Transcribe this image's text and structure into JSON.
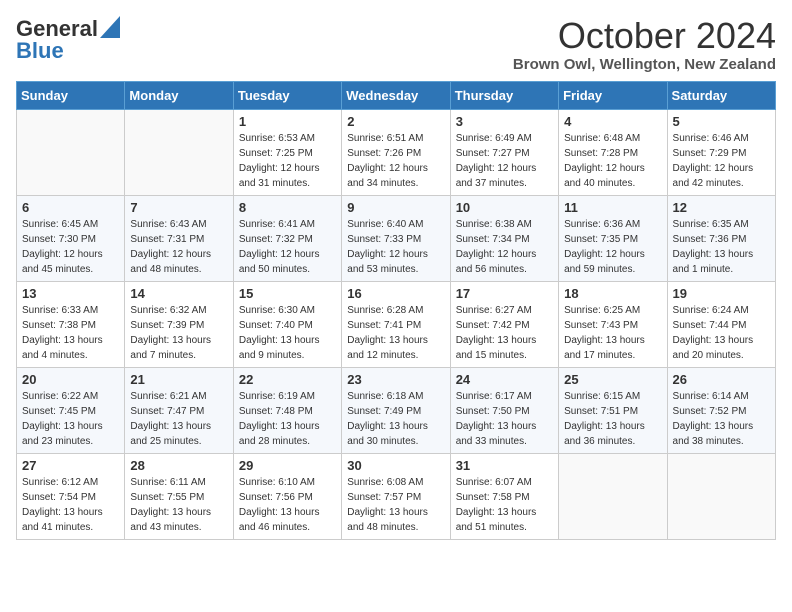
{
  "header": {
    "logo_line1": "General",
    "logo_line2": "Blue",
    "month": "October 2024",
    "location": "Brown Owl, Wellington, New Zealand"
  },
  "days_of_week": [
    "Sunday",
    "Monday",
    "Tuesday",
    "Wednesday",
    "Thursday",
    "Friday",
    "Saturday"
  ],
  "weeks": [
    [
      {
        "day": "",
        "sunrise": "",
        "sunset": "",
        "daylight": ""
      },
      {
        "day": "",
        "sunrise": "",
        "sunset": "",
        "daylight": ""
      },
      {
        "day": "1",
        "sunrise": "Sunrise: 6:53 AM",
        "sunset": "Sunset: 7:25 PM",
        "daylight": "Daylight: 12 hours and 31 minutes."
      },
      {
        "day": "2",
        "sunrise": "Sunrise: 6:51 AM",
        "sunset": "Sunset: 7:26 PM",
        "daylight": "Daylight: 12 hours and 34 minutes."
      },
      {
        "day": "3",
        "sunrise": "Sunrise: 6:49 AM",
        "sunset": "Sunset: 7:27 PM",
        "daylight": "Daylight: 12 hours and 37 minutes."
      },
      {
        "day": "4",
        "sunrise": "Sunrise: 6:48 AM",
        "sunset": "Sunset: 7:28 PM",
        "daylight": "Daylight: 12 hours and 40 minutes."
      },
      {
        "day": "5",
        "sunrise": "Sunrise: 6:46 AM",
        "sunset": "Sunset: 7:29 PM",
        "daylight": "Daylight: 12 hours and 42 minutes."
      }
    ],
    [
      {
        "day": "6",
        "sunrise": "Sunrise: 6:45 AM",
        "sunset": "Sunset: 7:30 PM",
        "daylight": "Daylight: 12 hours and 45 minutes."
      },
      {
        "day": "7",
        "sunrise": "Sunrise: 6:43 AM",
        "sunset": "Sunset: 7:31 PM",
        "daylight": "Daylight: 12 hours and 48 minutes."
      },
      {
        "day": "8",
        "sunrise": "Sunrise: 6:41 AM",
        "sunset": "Sunset: 7:32 PM",
        "daylight": "Daylight: 12 hours and 50 minutes."
      },
      {
        "day": "9",
        "sunrise": "Sunrise: 6:40 AM",
        "sunset": "Sunset: 7:33 PM",
        "daylight": "Daylight: 12 hours and 53 minutes."
      },
      {
        "day": "10",
        "sunrise": "Sunrise: 6:38 AM",
        "sunset": "Sunset: 7:34 PM",
        "daylight": "Daylight: 12 hours and 56 minutes."
      },
      {
        "day": "11",
        "sunrise": "Sunrise: 6:36 AM",
        "sunset": "Sunset: 7:35 PM",
        "daylight": "Daylight: 12 hours and 59 minutes."
      },
      {
        "day": "12",
        "sunrise": "Sunrise: 6:35 AM",
        "sunset": "Sunset: 7:36 PM",
        "daylight": "Daylight: 13 hours and 1 minute."
      }
    ],
    [
      {
        "day": "13",
        "sunrise": "Sunrise: 6:33 AM",
        "sunset": "Sunset: 7:38 PM",
        "daylight": "Daylight: 13 hours and 4 minutes."
      },
      {
        "day": "14",
        "sunrise": "Sunrise: 6:32 AM",
        "sunset": "Sunset: 7:39 PM",
        "daylight": "Daylight: 13 hours and 7 minutes."
      },
      {
        "day": "15",
        "sunrise": "Sunrise: 6:30 AM",
        "sunset": "Sunset: 7:40 PM",
        "daylight": "Daylight: 13 hours and 9 minutes."
      },
      {
        "day": "16",
        "sunrise": "Sunrise: 6:28 AM",
        "sunset": "Sunset: 7:41 PM",
        "daylight": "Daylight: 13 hours and 12 minutes."
      },
      {
        "day": "17",
        "sunrise": "Sunrise: 6:27 AM",
        "sunset": "Sunset: 7:42 PM",
        "daylight": "Daylight: 13 hours and 15 minutes."
      },
      {
        "day": "18",
        "sunrise": "Sunrise: 6:25 AM",
        "sunset": "Sunset: 7:43 PM",
        "daylight": "Daylight: 13 hours and 17 minutes."
      },
      {
        "day": "19",
        "sunrise": "Sunrise: 6:24 AM",
        "sunset": "Sunset: 7:44 PM",
        "daylight": "Daylight: 13 hours and 20 minutes."
      }
    ],
    [
      {
        "day": "20",
        "sunrise": "Sunrise: 6:22 AM",
        "sunset": "Sunset: 7:45 PM",
        "daylight": "Daylight: 13 hours and 23 minutes."
      },
      {
        "day": "21",
        "sunrise": "Sunrise: 6:21 AM",
        "sunset": "Sunset: 7:47 PM",
        "daylight": "Daylight: 13 hours and 25 minutes."
      },
      {
        "day": "22",
        "sunrise": "Sunrise: 6:19 AM",
        "sunset": "Sunset: 7:48 PM",
        "daylight": "Daylight: 13 hours and 28 minutes."
      },
      {
        "day": "23",
        "sunrise": "Sunrise: 6:18 AM",
        "sunset": "Sunset: 7:49 PM",
        "daylight": "Daylight: 13 hours and 30 minutes."
      },
      {
        "day": "24",
        "sunrise": "Sunrise: 6:17 AM",
        "sunset": "Sunset: 7:50 PM",
        "daylight": "Daylight: 13 hours and 33 minutes."
      },
      {
        "day": "25",
        "sunrise": "Sunrise: 6:15 AM",
        "sunset": "Sunset: 7:51 PM",
        "daylight": "Daylight: 13 hours and 36 minutes."
      },
      {
        "day": "26",
        "sunrise": "Sunrise: 6:14 AM",
        "sunset": "Sunset: 7:52 PM",
        "daylight": "Daylight: 13 hours and 38 minutes."
      }
    ],
    [
      {
        "day": "27",
        "sunrise": "Sunrise: 6:12 AM",
        "sunset": "Sunset: 7:54 PM",
        "daylight": "Daylight: 13 hours and 41 minutes."
      },
      {
        "day": "28",
        "sunrise": "Sunrise: 6:11 AM",
        "sunset": "Sunset: 7:55 PM",
        "daylight": "Daylight: 13 hours and 43 minutes."
      },
      {
        "day": "29",
        "sunrise": "Sunrise: 6:10 AM",
        "sunset": "Sunset: 7:56 PM",
        "daylight": "Daylight: 13 hours and 46 minutes."
      },
      {
        "day": "30",
        "sunrise": "Sunrise: 6:08 AM",
        "sunset": "Sunset: 7:57 PM",
        "daylight": "Daylight: 13 hours and 48 minutes."
      },
      {
        "day": "31",
        "sunrise": "Sunrise: 6:07 AM",
        "sunset": "Sunset: 7:58 PM",
        "daylight": "Daylight: 13 hours and 51 minutes."
      },
      {
        "day": "",
        "sunrise": "",
        "sunset": "",
        "daylight": ""
      },
      {
        "day": "",
        "sunrise": "",
        "sunset": "",
        "daylight": ""
      }
    ]
  ]
}
